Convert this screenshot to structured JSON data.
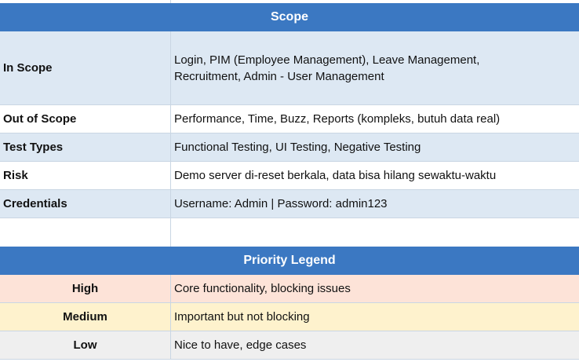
{
  "scope": {
    "title": "Scope",
    "rows": [
      {
        "label": "In Scope",
        "value": "Login, PIM (Employee Management), Leave Management, Recruitment, Admin - User Management"
      },
      {
        "label": "Out of Scope",
        "value": "Performance, Time, Buzz, Reports (kompleks, butuh data real)"
      },
      {
        "label": "Test Types",
        "value": "Functional Testing, UI Testing, Negative Testing"
      },
      {
        "label": "Risk",
        "value": "Demo server di-reset berkala, data bisa hilang sewaktu-waktu"
      },
      {
        "label": "Credentials",
        "value": "Username: Admin | Password: admin123"
      }
    ]
  },
  "priority": {
    "title": "Priority Legend",
    "rows": [
      {
        "level": "High",
        "description": "Core functionality, blocking issues"
      },
      {
        "level": "Medium",
        "description": "Important but not blocking"
      },
      {
        "level": "Low",
        "description": "Nice to have, edge cases"
      }
    ]
  },
  "colors": {
    "header_bg": "#3b78c2",
    "row_blue": "#dde8f3",
    "high_bg": "#fde3d8",
    "medium_bg": "#fef2cd",
    "low_bg": "#efefef"
  }
}
